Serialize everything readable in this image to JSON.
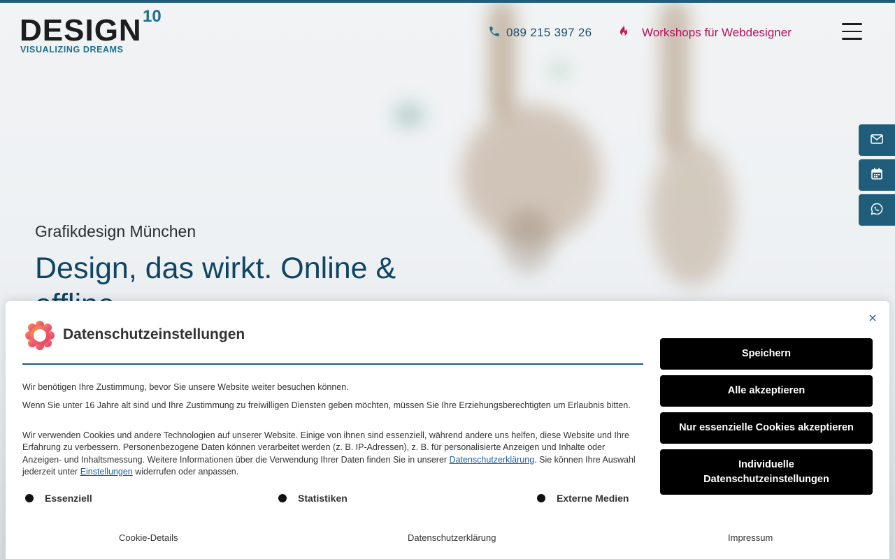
{
  "brand": {
    "logo_word": "DESIGN",
    "logo_number": "10",
    "tagline": "VISUALIZING DREAMS",
    "accent_color": "#1f5d7a",
    "highlight_color": "#b5115e"
  },
  "header": {
    "phone": "089 215 397 26",
    "phone_icon": "phone-icon",
    "workshop_label": "Workshops für Webdesigner",
    "workshop_icon": "flame-icon",
    "menu_icon": "hamburger-menu-icon"
  },
  "side_tabs": [
    {
      "icon": "mail-icon"
    },
    {
      "icon": "calendar-icon"
    },
    {
      "icon": "whatsapp-icon"
    }
  ],
  "hero": {
    "subtitle": "Grafikdesign München",
    "title": "Design, das wirkt. Online & offline."
  },
  "cookie": {
    "title": "Datenschutzeinstellungen",
    "para1": "Wir benötigen Ihre Zustimmung, bevor Sie unsere Website weiter besuchen können.",
    "para2": "Wenn Sie unter 16 Jahre alt sind und Ihre Zustimmung zu freiwilligen Diensten geben möchten, müssen Sie Ihre Erziehungsberechtigten um Erlaubnis bitten.",
    "para3_a": "Wir verwenden Cookies und andere Technologien auf unserer Website. Einige von ihnen sind essenziell, während andere uns helfen, diese Website und Ihre Erfahrung zu verbessern. Personenbezogene Daten können verarbeitet werden (z. B. IP-Adressen), z. B. für personalisierte Anzeigen und Inhalte oder Anzeigen- und Inhaltsmessung. Weitere Informationen über die Verwendung Ihrer Daten finden Sie in unserer ",
    "para3_link1": "Datenschutzerklärung",
    "para3_b": ". Sie können Ihre Auswahl jederzeit unter ",
    "para3_link2": "Einstellungen",
    "para3_c": " widerrufen oder anpassen.",
    "categories": [
      "Essenziell",
      "Statistiken",
      "Externe Medien"
    ],
    "buttons": {
      "save": "Speichern",
      "accept_all": "Alle akzeptieren",
      "essential_only": "Nur essenzielle Cookies akzeptieren",
      "individual_line1": "Individuelle",
      "individual_line2": "Datenschutzeinstellungen"
    },
    "footer_links": [
      "Cookie-Details",
      "Datenschutzerklärung",
      "Impressum"
    ]
  }
}
